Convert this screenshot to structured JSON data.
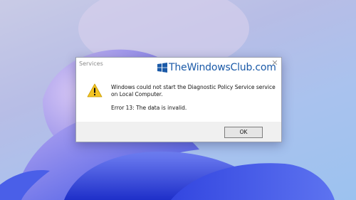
{
  "desktop": {
    "wallpaper": "windows-11-bloom",
    "colors": {
      "background": "#b9c2ea",
      "bloom_primary": "#2f45e0",
      "bloom_secondary": "#7f8df5",
      "bloom_highlight": "#c9b8f2"
    }
  },
  "dialog": {
    "title": "Services",
    "close_icon": "close-icon",
    "watermark": "TheWindowsClub.com",
    "watermark_icon": "windows-logo-icon",
    "icon": "warning-icon",
    "message": "Windows could not start the Diagnostic Policy Service service on Local Computer.",
    "error": "Error 13: The data is invalid.",
    "ok_label": "OK",
    "colors": {
      "warning": "#f3c423",
      "accent": "#1b5aa8"
    }
  }
}
